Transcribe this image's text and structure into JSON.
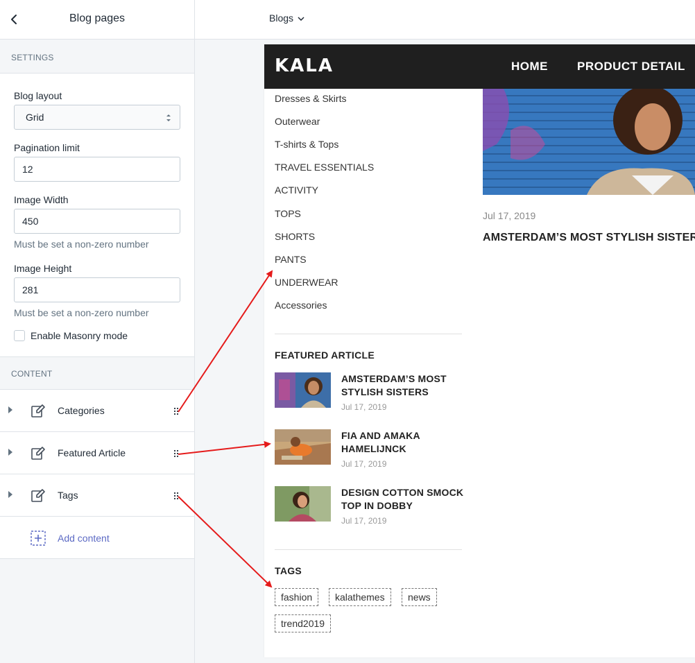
{
  "editor": {
    "title": "Blog pages",
    "settings_label": "SETTINGS",
    "blog_layout": {
      "label": "Blog layout",
      "value": "Grid"
    },
    "pagination": {
      "label": "Pagination limit",
      "value": "12"
    },
    "image_width": {
      "label": "Image Width",
      "value": "450",
      "help": "Must be set a non-zero number"
    },
    "image_height": {
      "label": "Image Height",
      "value": "281",
      "help": "Must be set a non-zero number"
    },
    "masonry": {
      "label": "Enable Masonry mode",
      "checked": false
    },
    "content_label": "CONTENT",
    "content_items": [
      {
        "label": "Categories"
      },
      {
        "label": "Featured Article"
      },
      {
        "label": "Tags"
      }
    ],
    "add_content": "Add content"
  },
  "topbar": {
    "dropdown": "Blogs"
  },
  "store": {
    "logo": "KALA",
    "nav": [
      "HOME",
      "PRODUCT DETAIL"
    ],
    "categories": [
      "Dresses & Skirts",
      "Outerwear",
      "T-shirts & Tops",
      "TRAVEL ESSENTIALS",
      "ACTIVITY",
      "TOPS",
      "SHORTS",
      "PANTS",
      "UNDERWEAR",
      "Accessories"
    ],
    "featured": {
      "title": "FEATURED ARTICLE",
      "items": [
        {
          "title": "AMSTERDAM’S MOST STYLISH SISTERS",
          "date": "Jul 17, 2019"
        },
        {
          "title": "FIA AND AMAKA HAMELIJNCK",
          "date": "Jul 17, 2019"
        },
        {
          "title": "DESIGN COTTON SMOCK TOP IN DOBBY",
          "date": "Jul 17, 2019"
        }
      ]
    },
    "tags": {
      "title": "TAGS",
      "items": [
        "fashion",
        "kalathemes",
        "news",
        "trend2019"
      ]
    },
    "article": {
      "date": "Jul 17, 2019",
      "title": "AMSTERDAM’S MOST STYLISH SISTERS"
    }
  },
  "colors": {
    "accent": "#5c6ac4",
    "header_bg": "#1f1f1f",
    "annotation_arrow": "#e51b1b"
  }
}
